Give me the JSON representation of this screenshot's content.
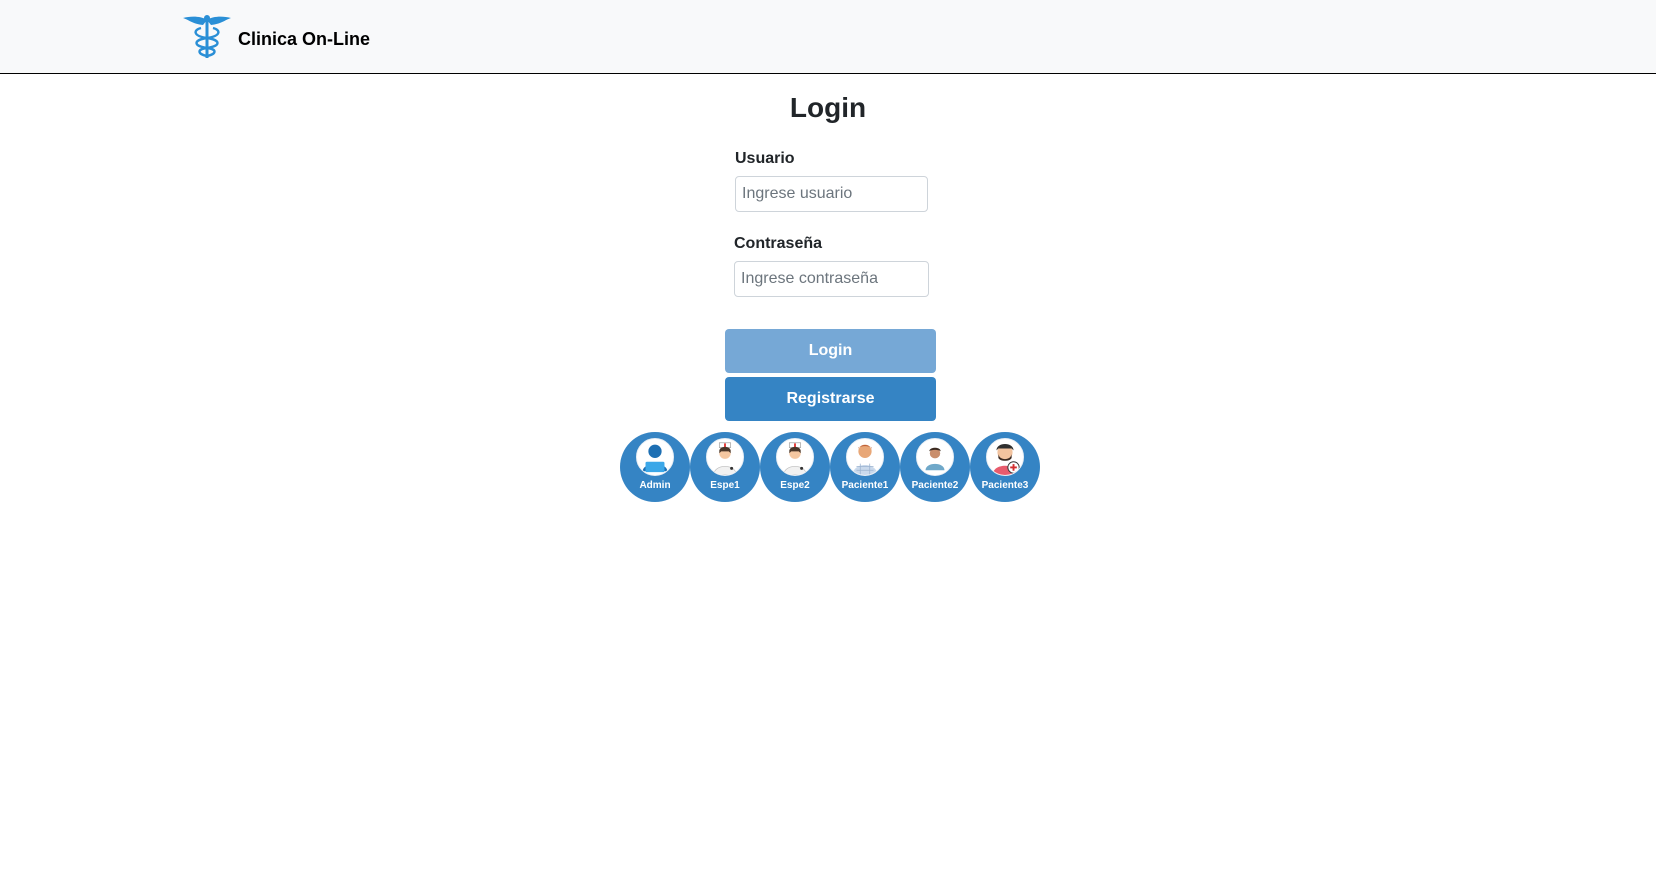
{
  "navbar": {
    "brand_title": "Clinica On-Line",
    "logo_icon": "caduceus-icon"
  },
  "login": {
    "title": "Login",
    "usuario": {
      "label": "Usuario",
      "placeholder": "Ingrese usuario",
      "value": ""
    },
    "password": {
      "label": "Contraseña",
      "placeholder": "Ingrese contraseña",
      "value": ""
    },
    "login_button": "Login",
    "register_button": "Registrarse"
  },
  "quick_access": [
    {
      "label": "Admin",
      "icon": "admin-avatar-icon"
    },
    {
      "label": "Espe1",
      "icon": "nurse-avatar-icon"
    },
    {
      "label": "Espe2",
      "icon": "nurse-avatar-icon"
    },
    {
      "label": "Paciente1",
      "icon": "patient-avatar-icon"
    },
    {
      "label": "Paciente2",
      "icon": "patient-avatar-icon"
    },
    {
      "label": "Paciente3",
      "icon": "patient-avatar-icon"
    }
  ],
  "colors": {
    "primary": "#3584c4",
    "primary_disabled": "#76a8d6",
    "navbar_bg": "#f8f9fa",
    "logo": "#2a8fd6"
  }
}
